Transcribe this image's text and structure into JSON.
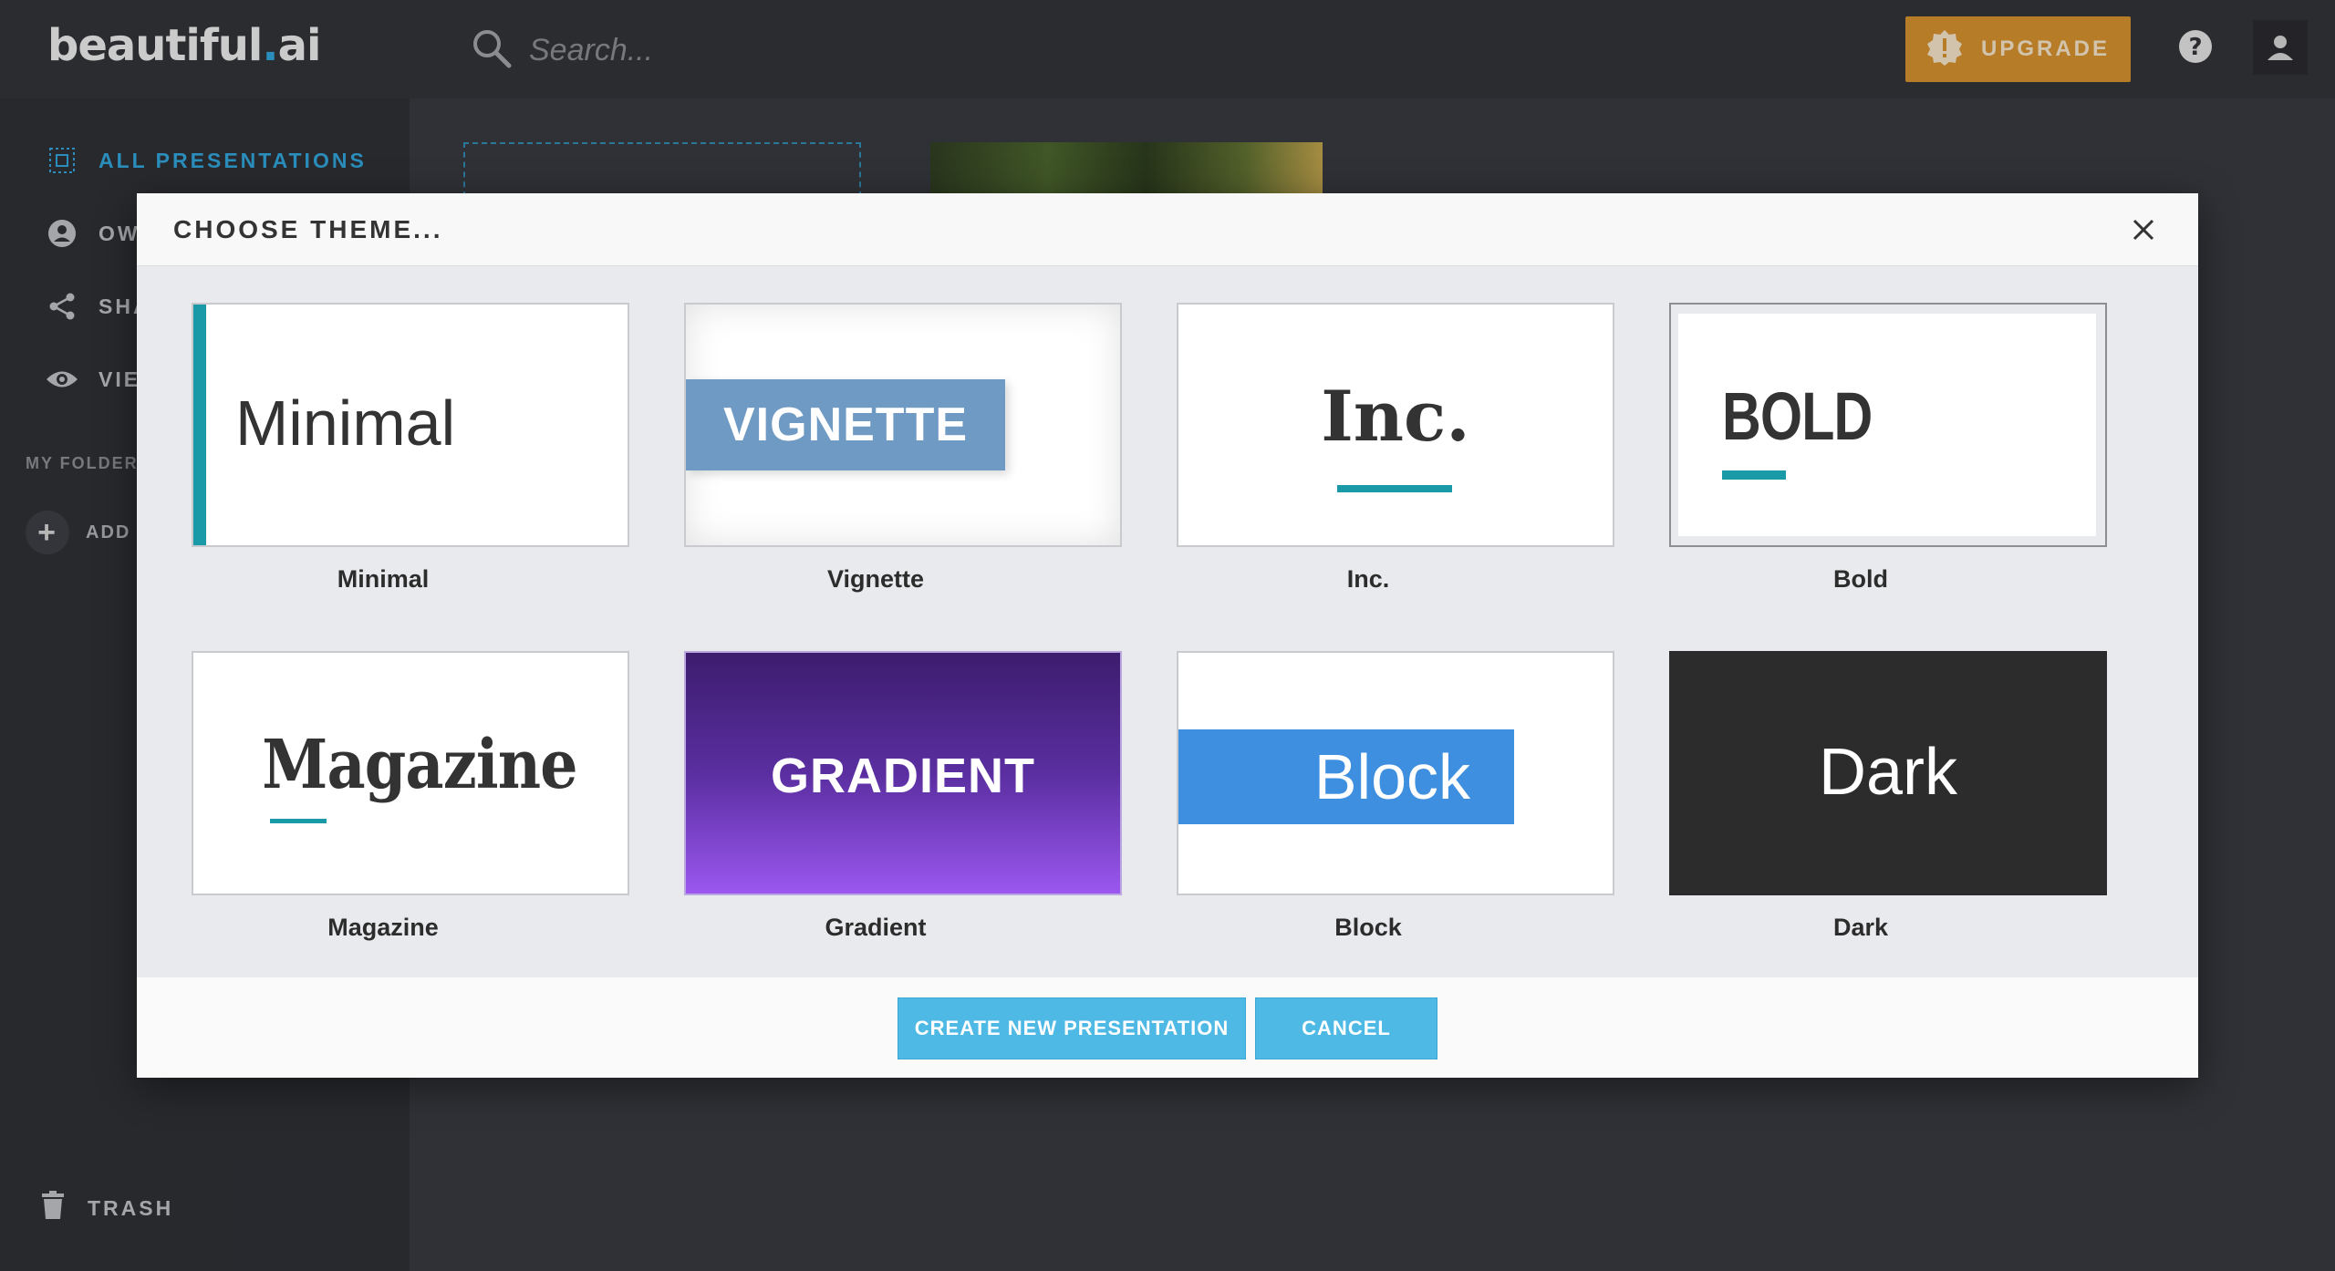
{
  "app": {
    "logo_main": "beautiful",
    "logo_dot": ".",
    "logo_suffix": "ai"
  },
  "search": {
    "placeholder": "Search..."
  },
  "topbar": {
    "upgrade_label": "UPGRADE"
  },
  "sidebar": {
    "items": [
      {
        "label": "ALL PRESENTATIONS",
        "icon": "grid-select-icon",
        "active": true
      },
      {
        "label": "OW",
        "icon": "user-circle-icon"
      },
      {
        "label": "SHA",
        "icon": "share-icon"
      },
      {
        "label": "VIE",
        "icon": "eye-icon"
      }
    ],
    "folders_label": "MY FOLDERS",
    "add_folder_label": "ADD F",
    "trash_label": "TRASH"
  },
  "modal": {
    "title": "CHOOSE THEME...",
    "themes": [
      {
        "name": "Minimal",
        "thumb_text": "Minimal"
      },
      {
        "name": "Vignette",
        "thumb_text": "VIGNETTE"
      },
      {
        "name": "Inc.",
        "thumb_text": "Inc."
      },
      {
        "name": "Bold",
        "thumb_text": "BOLD"
      },
      {
        "name": "Magazine",
        "thumb_text": "Magazine"
      },
      {
        "name": "Gradient",
        "thumb_text": "GRADIENT"
      },
      {
        "name": "Block",
        "thumb_text": "Block"
      },
      {
        "name": "Dark",
        "thumb_text": "Dark"
      }
    ],
    "create_label": "CREATE NEW PRESENTATION",
    "cancel_label": "CANCEL"
  },
  "colors": {
    "accent_teal": "#1a9aa6",
    "brand_blue": "#2ea7de",
    "upgrade_orange": "#d9922a",
    "button_blue": "#4fb9e6",
    "vignette_blue": "#6f9ac4",
    "block_blue": "#3e8fe0",
    "dark_bg": "#2c2c2c",
    "gradient_top": "#3d1d6e",
    "gradient_bottom": "#9b57f0"
  }
}
